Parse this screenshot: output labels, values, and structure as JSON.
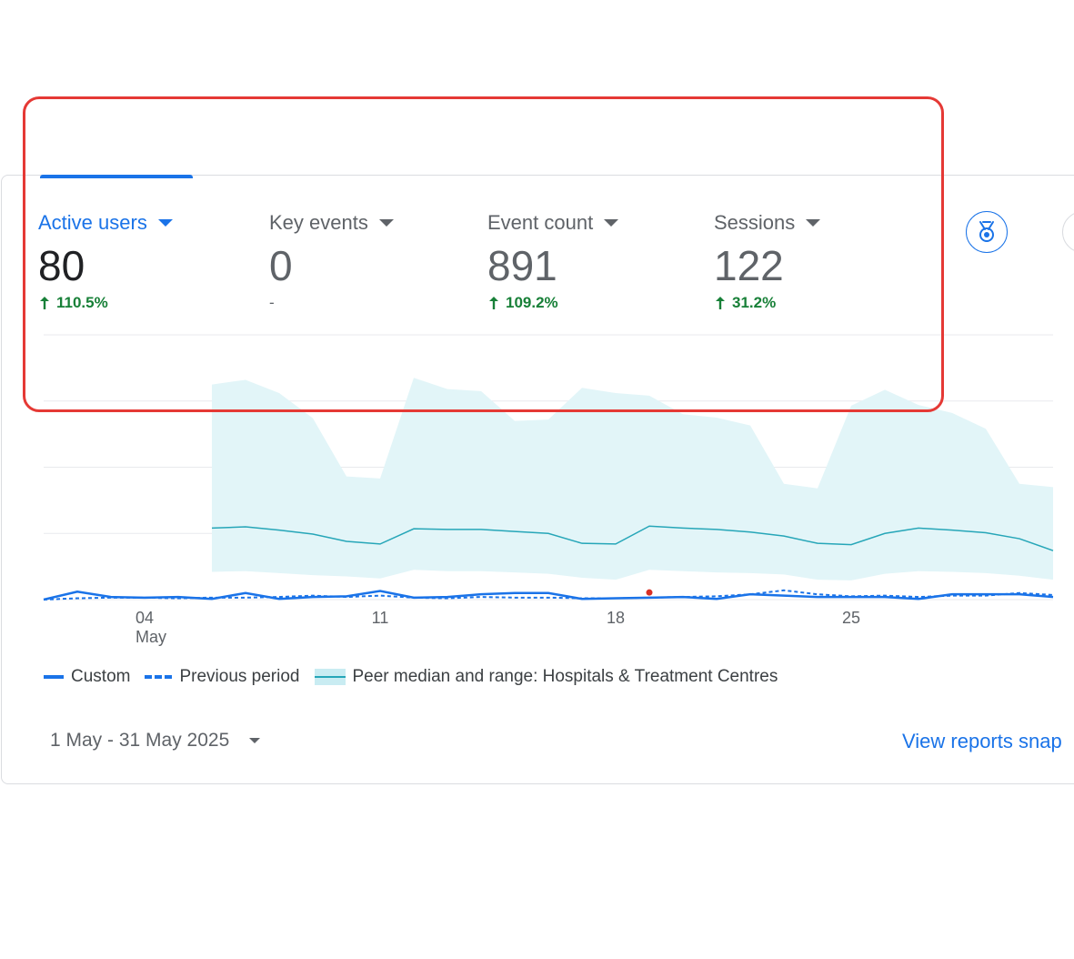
{
  "metrics": [
    {
      "label": "Active users",
      "value": "80",
      "change": "110.5%",
      "trend": "up",
      "active": true
    },
    {
      "label": "Key events",
      "value": "0",
      "change": "-",
      "trend": "none",
      "active": false
    },
    {
      "label": "Event count",
      "value": "891",
      "change": "109.2%",
      "trend": "up",
      "active": false
    },
    {
      "label": "Sessions",
      "value": "122",
      "change": "31.2%",
      "trend": "up",
      "active": false
    }
  ],
  "icons": {
    "insights": "medal-insight-icon",
    "trend_up": "arrow-up-icon",
    "dropdown": "caret-down-icon"
  },
  "colors": {
    "accent": "#1a73e8",
    "positive": "#188038",
    "peer_band": "#e2f5f8",
    "peer_line": "#26a6b8",
    "anomaly": "#d93025",
    "highlight": "#e53935"
  },
  "chart_data": {
    "type": "line",
    "x_ticks": [
      {
        "day": 4,
        "label": "04",
        "sublabel": "May"
      },
      {
        "day": 11,
        "label": "11"
      },
      {
        "day": 18,
        "label": "18"
      },
      {
        "day": 25,
        "label": "25"
      }
    ],
    "x_domain": [
      1,
      31
    ],
    "y_domain": [
      0,
      40
    ],
    "grid": true,
    "legend_position": "bottom",
    "series": [
      {
        "name": "Custom",
        "style": "solid",
        "values": [
          0,
          1.2,
          0.4,
          0.3,
          0.4,
          0.1,
          1.0,
          0.1,
          0.4,
          0.5,
          1.3,
          0.3,
          0.4,
          0.8,
          1.0,
          1.0,
          0.1,
          0.2,
          0.3,
          0.4,
          0.1,
          0.8,
          0.6,
          0.4,
          0.4,
          0.4,
          0.1,
          0.8,
          0.8,
          0.8,
          0.4
        ]
      },
      {
        "name": "Previous period",
        "style": "dashed",
        "values": [
          0,
          0.2,
          0.3,
          0.3,
          0.2,
          0.3,
          0.3,
          0.4,
          0.6,
          0.4,
          0.6,
          0.3,
          0.2,
          0.4,
          0.3,
          0.3,
          0.2,
          0.2,
          0.3,
          0.4,
          0.5,
          0.8,
          1.4,
          0.8,
          0.5,
          0.6,
          0.4,
          0.6,
          0.6,
          1.0,
          0.7
        ]
      },
      {
        "name": "Peer median and range: Hospitals & Treatment Centres",
        "style": "band",
        "start_day": 6,
        "median": [
          10.8,
          11.0,
          10.5,
          9.9,
          8.8,
          8.4,
          10.7,
          10.6,
          10.6,
          10.3,
          10.0,
          8.5,
          8.4,
          11.1,
          10.8,
          10.6,
          10.2,
          9.6,
          8.5,
          8.3,
          10.0,
          10.8,
          10.5,
          10.1,
          9.2,
          7.4
        ],
        "low": [
          4.2,
          4.3,
          4.0,
          3.7,
          3.5,
          3.2,
          4.5,
          4.3,
          4.3,
          4.1,
          3.9,
          3.3,
          3.0,
          4.5,
          4.3,
          4.1,
          4.0,
          3.8,
          3.0,
          2.9,
          3.9,
          4.3,
          4.2,
          4.0,
          3.6,
          3.0
        ],
        "high": [
          32.5,
          33.2,
          31.2,
          27.4,
          18.6,
          18.3,
          33.5,
          31.8,
          31.5,
          27.0,
          27.2,
          32.0,
          31.2,
          30.8,
          28.0,
          27.5,
          26.3,
          17.5,
          16.8,
          29.3,
          31.7,
          29.4,
          28.2,
          25.8,
          17.5,
          17.0
        ]
      }
    ],
    "anomaly_points": [
      {
        "day": 19,
        "value": 0.8
      }
    ]
  },
  "legend": {
    "custom": "Custom",
    "previous": "Previous period",
    "peer": "Peer median and range: Hospitals & Treatment Centres"
  },
  "date_range": "1 May - 31 May 2025",
  "view_link": "View reports snap"
}
